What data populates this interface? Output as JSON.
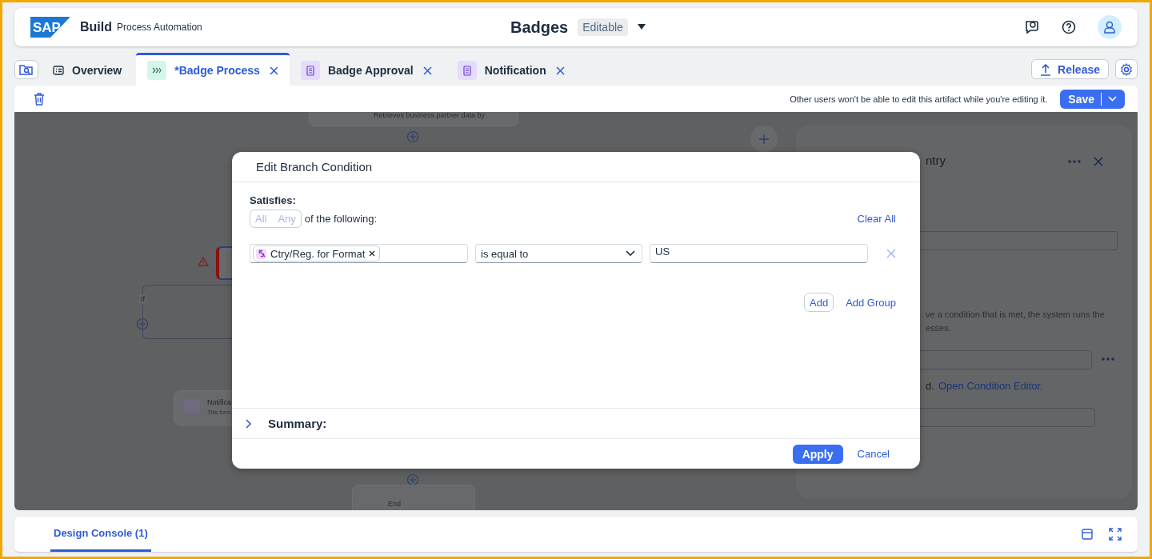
{
  "header": {
    "logo": "SAP",
    "product": "Build",
    "subtitle": "Process Automation",
    "title": "Badges",
    "status": "Editable"
  },
  "tabs": [
    {
      "label": "Overview",
      "kind": "overview",
      "selected": false,
      "closable": false
    },
    {
      "label": "*Badge Process",
      "kind": "process",
      "selected": true,
      "closable": true
    },
    {
      "label": "Badge Approval",
      "kind": "form",
      "selected": false,
      "closable": true
    },
    {
      "label": "Notification",
      "kind": "form",
      "selected": false,
      "closable": true
    }
  ],
  "release": "Release",
  "toolbar": {
    "notice": "Other users won't be able to edit this artifact while you're editing it.",
    "save": "Save"
  },
  "canvas": {
    "task": "Retrieves business partner data by",
    "if_label": "If",
    "form_title": "Notifica",
    "form_subtitle": "This form",
    "end": "End"
  },
  "side_panel": {
    "title": "ntry",
    "line_1": "ve a condition that is met, the system runs the",
    "line_2": "esses.",
    "note": "d.",
    "link": "Open Condition Editor."
  },
  "dialog": {
    "title": "Edit Branch Condition",
    "satisfies": "Satisfies:",
    "modes": [
      {
        "label": "All",
        "selected": false
      },
      {
        "label": "Any",
        "selected": false
      }
    ],
    "modes_disabled": true,
    "following": "of the following:",
    "clear_all": "Clear All",
    "conditions": [
      {
        "field": "Ctry/Reg. for Format",
        "operator": "is equal to",
        "value": "US"
      }
    ],
    "add": "Add",
    "add_group": "Add Group",
    "summary": {
      "label": "Summary:",
      "expanded": false
    },
    "apply": "Apply",
    "cancel": "Cancel"
  },
  "console": {
    "tabs": [
      {
        "label": "Design Console (1)",
        "selected": true
      }
    ]
  }
}
